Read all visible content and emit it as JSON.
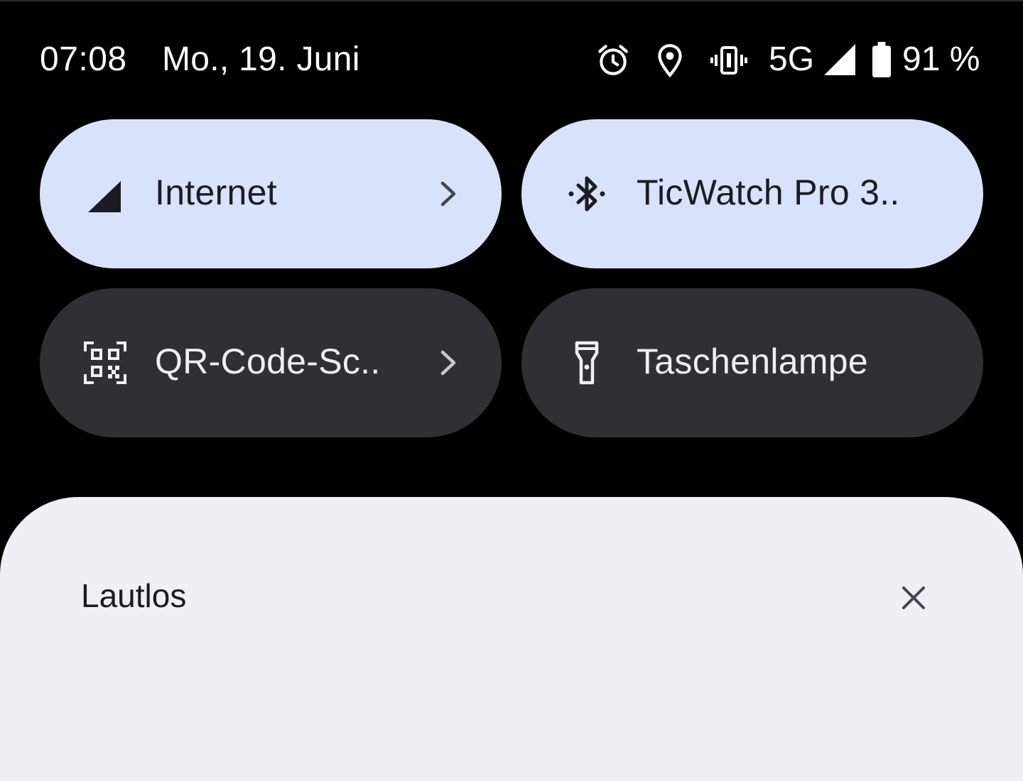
{
  "status_bar": {
    "time": "07:08",
    "date": "Mo., 19. Juni",
    "icons": [
      "alarm-icon",
      "location-icon",
      "vibrate-icon",
      "signal-icon",
      "battery-icon"
    ],
    "network": "5G",
    "battery": "91 %"
  },
  "tiles": [
    {
      "label": "Internet",
      "icon": "cellular-signal-icon",
      "active": true,
      "has_chevron": true
    },
    {
      "label": "TicWatch Pro 3..",
      "icon": "bluetooth-icon",
      "active": true,
      "has_chevron": false
    },
    {
      "label": "QR-Code-Sc..",
      "icon": "qr-code-icon",
      "active": false,
      "has_chevron": true
    },
    {
      "label": "Taschenlampe",
      "icon": "flashlight-icon",
      "active": false,
      "has_chevron": false
    }
  ],
  "colors": {
    "background": "#000000",
    "tile_active": "#d9e2fb",
    "tile_inactive": "#303034",
    "sheet": "#f0eff6"
  },
  "notification_sheet": {
    "title": "Lautlos"
  }
}
